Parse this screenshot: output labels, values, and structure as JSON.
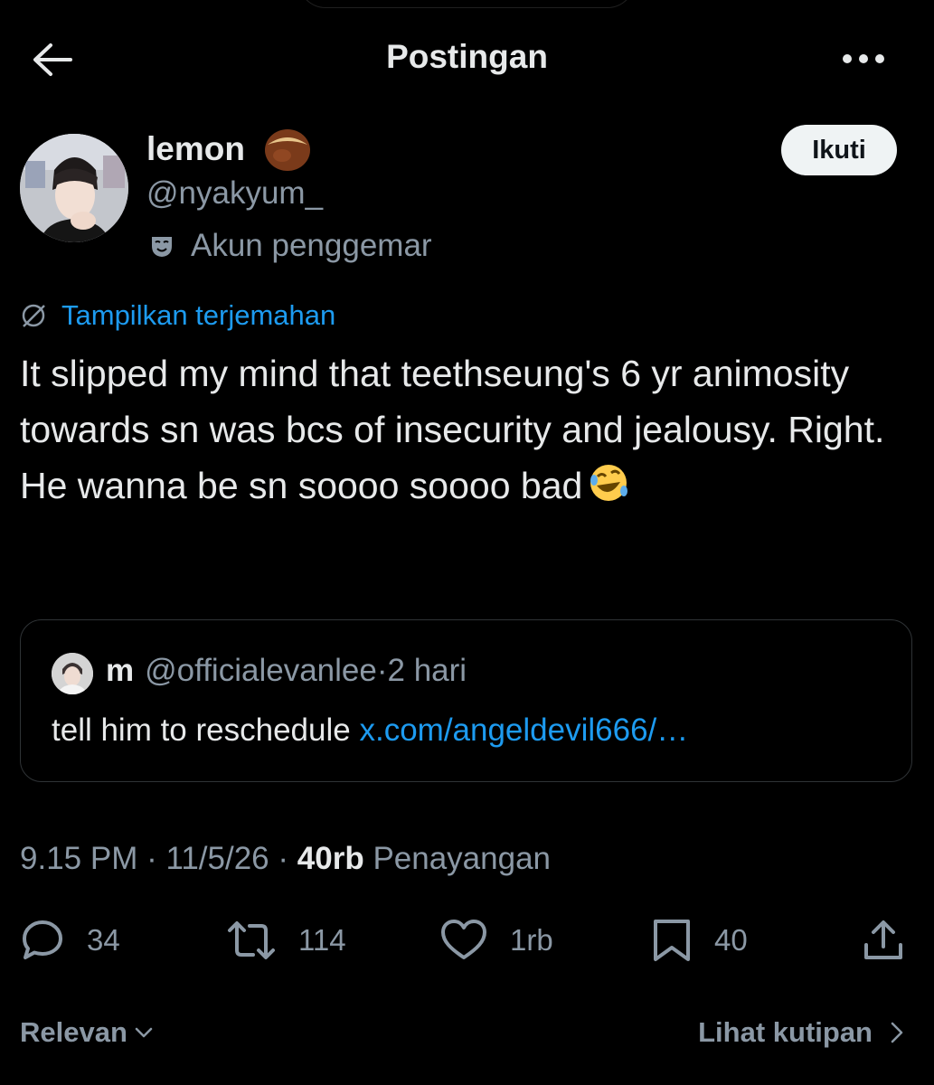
{
  "header": {
    "title": "Postingan",
    "back_icon": "arrow-left-icon",
    "more_icon": "more-horizontal-icon"
  },
  "author": {
    "display_name": "lemon",
    "name_emoji": "chestnut-emoji",
    "handle": "@nyakyum_",
    "badge_label": "Akun penggemar",
    "badge_icon": "mask-icon",
    "follow_label": "Ikuti"
  },
  "translate": {
    "label": "Tampilkan terjemahan",
    "icon": "globe-slash-icon"
  },
  "tweet": {
    "text": "It slipped my mind that teethseung's 6 yr animosity towards sn was bcs of insecurity and jealousy.  Right. He wanna be sn soooo soooo bad",
    "trailing_emoji": "rolling-on-floor-laughing-emoji"
  },
  "quote": {
    "name": "m",
    "handle": "@officialevanlee",
    "separator": "·",
    "time": "2 hari",
    "body": "tell him to reschedule",
    "link": "x.com/angeldevil666/…"
  },
  "meta": {
    "time": "9.15 PM",
    "sep1": " · ",
    "date": "11/5/26",
    "sep2": " · ",
    "views_count": "40rb",
    "views_label": "Penayangan"
  },
  "actions": {
    "replies": "34",
    "reposts": "114",
    "likes": "1rb",
    "bookmarks": "40"
  },
  "footer": {
    "sort_label": "Relevan",
    "quotes_label": "Lihat kutipan"
  },
  "colors": {
    "background": "#000000",
    "text_primary": "#e7e9ea",
    "text_secondary": "#8b98a5",
    "link": "#1d9bf0",
    "follow_button_bg": "#eff3f4"
  }
}
